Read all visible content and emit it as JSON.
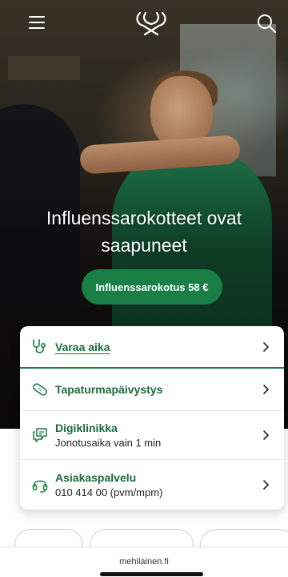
{
  "header": {
    "menu_icon": "hamburger-menu-icon",
    "logo_icon": "mehilainen-logo",
    "search_icon": "search-icon"
  },
  "hero": {
    "headline_line1": "Influenssarokotteet ovat",
    "headline_line2": "saapuneet",
    "cta_label": "Influenssarokotus 58 €"
  },
  "quick_links": [
    {
      "icon": "stethoscope-icon",
      "title": "Varaa aika",
      "subtitle": ""
    },
    {
      "icon": "bandage-icon",
      "title": "Tapaturmapäivystys",
      "subtitle": ""
    },
    {
      "icon": "chat-icon",
      "title": "Digiklinikka",
      "subtitle": "Jonotusaika vain 1 min"
    },
    {
      "icon": "headset-icon",
      "title": "Asiakaspalvelu",
      "subtitle": "010 414 00 (pvm/mpm)"
    }
  ],
  "browser": {
    "url": "mehilainen.fi"
  },
  "colors": {
    "brand_green": "#1a7f45",
    "link_green": "#1a6b3c"
  }
}
